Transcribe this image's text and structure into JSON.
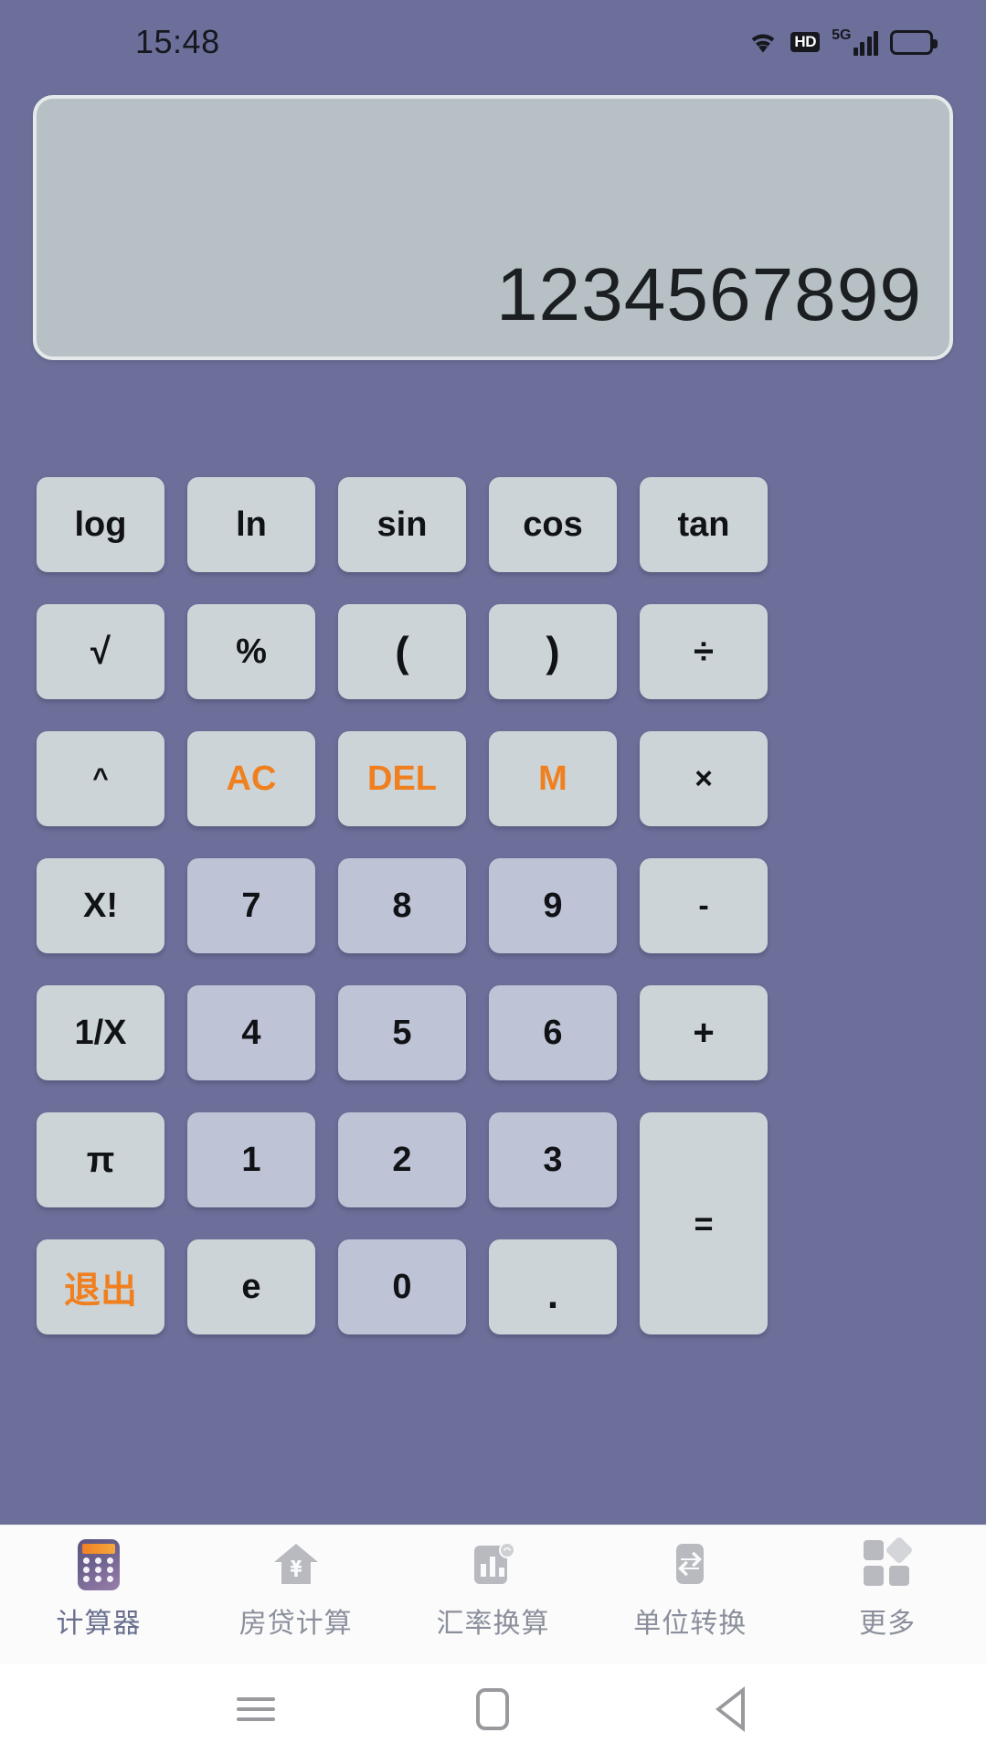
{
  "status_bar": {
    "time": "15:48",
    "hd_label": "HD",
    "network_label": "5G",
    "icons": [
      "wifi-icon",
      "hd-icon",
      "signal-icon",
      "battery-icon"
    ]
  },
  "display": {
    "value": "1234567899",
    "background_color": "#b7c0c4",
    "text_color": "#1b1f22"
  },
  "theme": {
    "app_background": "#6b6f99",
    "key_background": "#ccd4d8",
    "number_key_background": "#bec3d6",
    "accent_color": "#f0801f"
  },
  "keypad": {
    "rows": [
      [
        {
          "label": "log",
          "type": "function"
        },
        {
          "label": "ln",
          "type": "function"
        },
        {
          "label": "sin",
          "type": "function"
        },
        {
          "label": "cos",
          "type": "function"
        },
        {
          "label": "tan",
          "type": "function"
        }
      ],
      [
        {
          "label": "√",
          "type": "function"
        },
        {
          "label": "%",
          "type": "function"
        },
        {
          "label": "(",
          "type": "function"
        },
        {
          "label": ")",
          "type": "function"
        },
        {
          "label": "÷",
          "type": "operator"
        }
      ],
      [
        {
          "label": "^",
          "type": "function"
        },
        {
          "label": "AC",
          "type": "accent"
        },
        {
          "label": "DEL",
          "type": "accent"
        },
        {
          "label": "M",
          "type": "accent"
        },
        {
          "label": "×",
          "type": "operator"
        }
      ],
      [
        {
          "label": "X!",
          "type": "function"
        },
        {
          "label": "7",
          "type": "number"
        },
        {
          "label": "8",
          "type": "number"
        },
        {
          "label": "9",
          "type": "number"
        },
        {
          "label": "-",
          "type": "operator"
        }
      ],
      [
        {
          "label": "1/X",
          "type": "function"
        },
        {
          "label": "4",
          "type": "number"
        },
        {
          "label": "5",
          "type": "number"
        },
        {
          "label": "6",
          "type": "number"
        },
        {
          "label": "+",
          "type": "operator"
        }
      ],
      [
        {
          "label": "π",
          "type": "function"
        },
        {
          "label": "1",
          "type": "number"
        },
        {
          "label": "2",
          "type": "number"
        },
        {
          "label": "3",
          "type": "number"
        },
        {
          "label": "=",
          "type": "equals"
        }
      ],
      [
        {
          "label": "退出",
          "type": "accent"
        },
        {
          "label": "e",
          "type": "function"
        },
        {
          "label": "0",
          "type": "number"
        },
        {
          "label": ".",
          "type": "function"
        }
      ]
    ]
  },
  "bottom_nav": {
    "items": [
      {
        "label": "计算器",
        "icon": "calculator-icon",
        "active": true
      },
      {
        "label": "房贷计算",
        "icon": "house-yen-icon",
        "active": false
      },
      {
        "label": "汇率换算",
        "icon": "bar-chart-icon",
        "active": false
      },
      {
        "label": "单位转换",
        "icon": "swap-arrows-icon",
        "active": false
      },
      {
        "label": "更多",
        "icon": "more-grid-icon",
        "active": false
      }
    ]
  },
  "android_nav": {
    "items": [
      "recents-icon",
      "home-icon",
      "back-icon"
    ]
  }
}
